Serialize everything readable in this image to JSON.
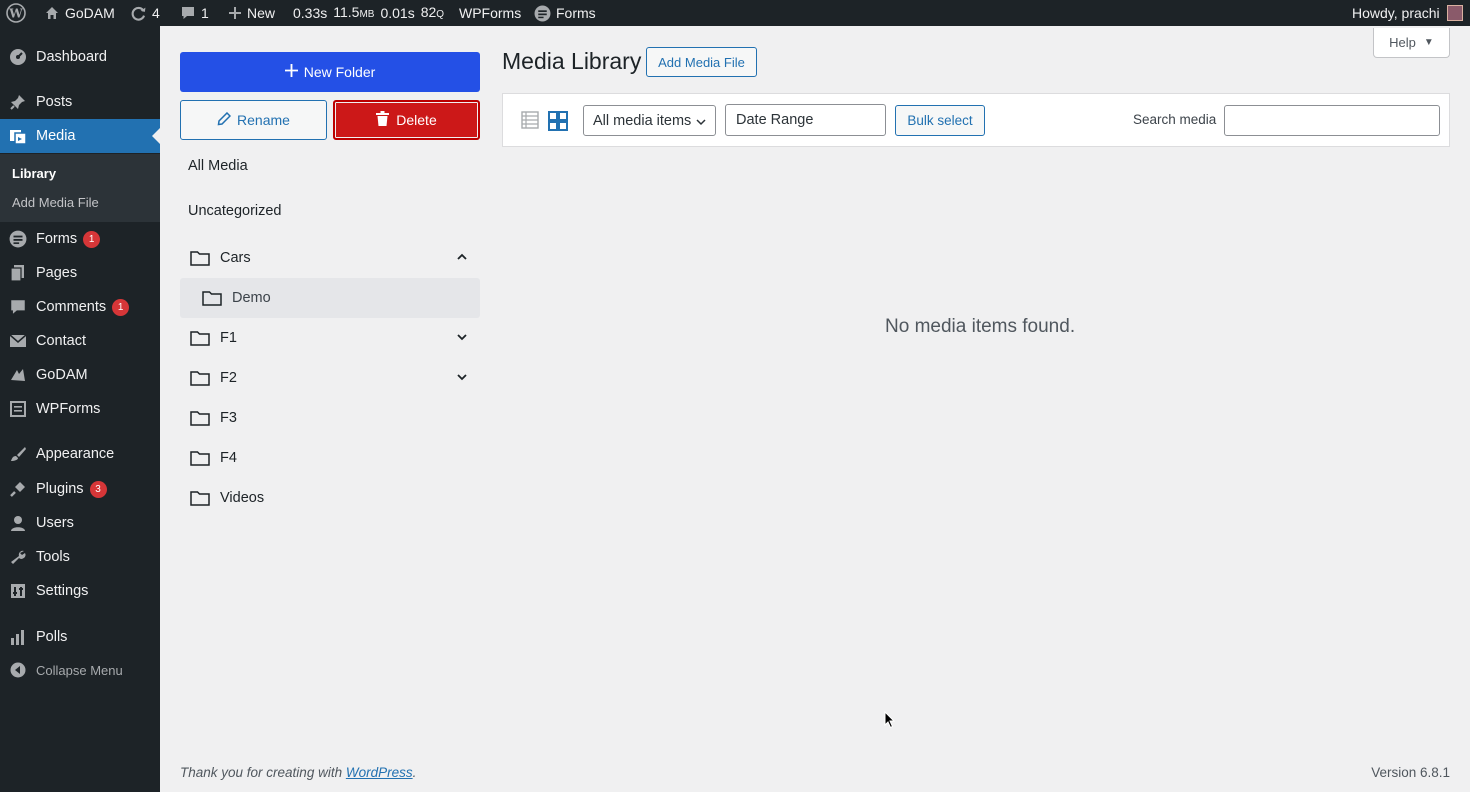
{
  "adminbar": {
    "site_name": "GoDAM",
    "updates_count": "4",
    "comments_count": "1",
    "new_label": "New",
    "qm_time": "0.33s",
    "qm_memory": "11.5",
    "qm_memory_unit": "MB",
    "qm_db_time": "0.01s",
    "qm_queries": "82",
    "qm_queries_unit": "Q",
    "wpforms_label": "WPForms",
    "forms_label": "Forms",
    "howdy": "Howdy, prachi"
  },
  "menu": {
    "dashboard": "Dashboard",
    "posts": "Posts",
    "media": "Media",
    "library": "Library",
    "add_media_file": "Add Media File",
    "forms": "Forms",
    "forms_badge": "1",
    "pages": "Pages",
    "comments": "Comments",
    "comments_badge": "1",
    "contact": "Contact",
    "godam": "GoDAM",
    "wpforms": "WPForms",
    "appearance": "Appearance",
    "plugins": "Plugins",
    "plugins_badge": "3",
    "users": "Users",
    "tools": "Tools",
    "settings": "Settings",
    "polls": "Polls",
    "collapse": "Collapse Menu"
  },
  "folders": {
    "new_folder": "New Folder",
    "rename": "Rename",
    "delete": "Delete",
    "all_media": "All Media",
    "uncategorized": "Uncategorized",
    "items": [
      "Cars",
      "Demo",
      "F1",
      "F2",
      "F3",
      "F4",
      "Videos"
    ]
  },
  "main": {
    "title": "Media Library",
    "add_media_button": "Add Media File",
    "help": "Help",
    "filter_select": "All media items",
    "date_range": "Date Range",
    "bulk_select": "Bulk select",
    "search_label": "Search media",
    "search_value": "",
    "empty_message": "No media items found."
  },
  "footer": {
    "thanks_prefix": "Thank you for creating with ",
    "thanks_link": "WordPress",
    "thanks_suffix": ".",
    "version": "Version 6.8.1"
  },
  "colors": {
    "adminbar_bg": "#1d2327",
    "accent": "#2271b1",
    "new_folder_bg": "#2450e6",
    "delete_bg": "#cc1818",
    "badge": "#d63638"
  }
}
